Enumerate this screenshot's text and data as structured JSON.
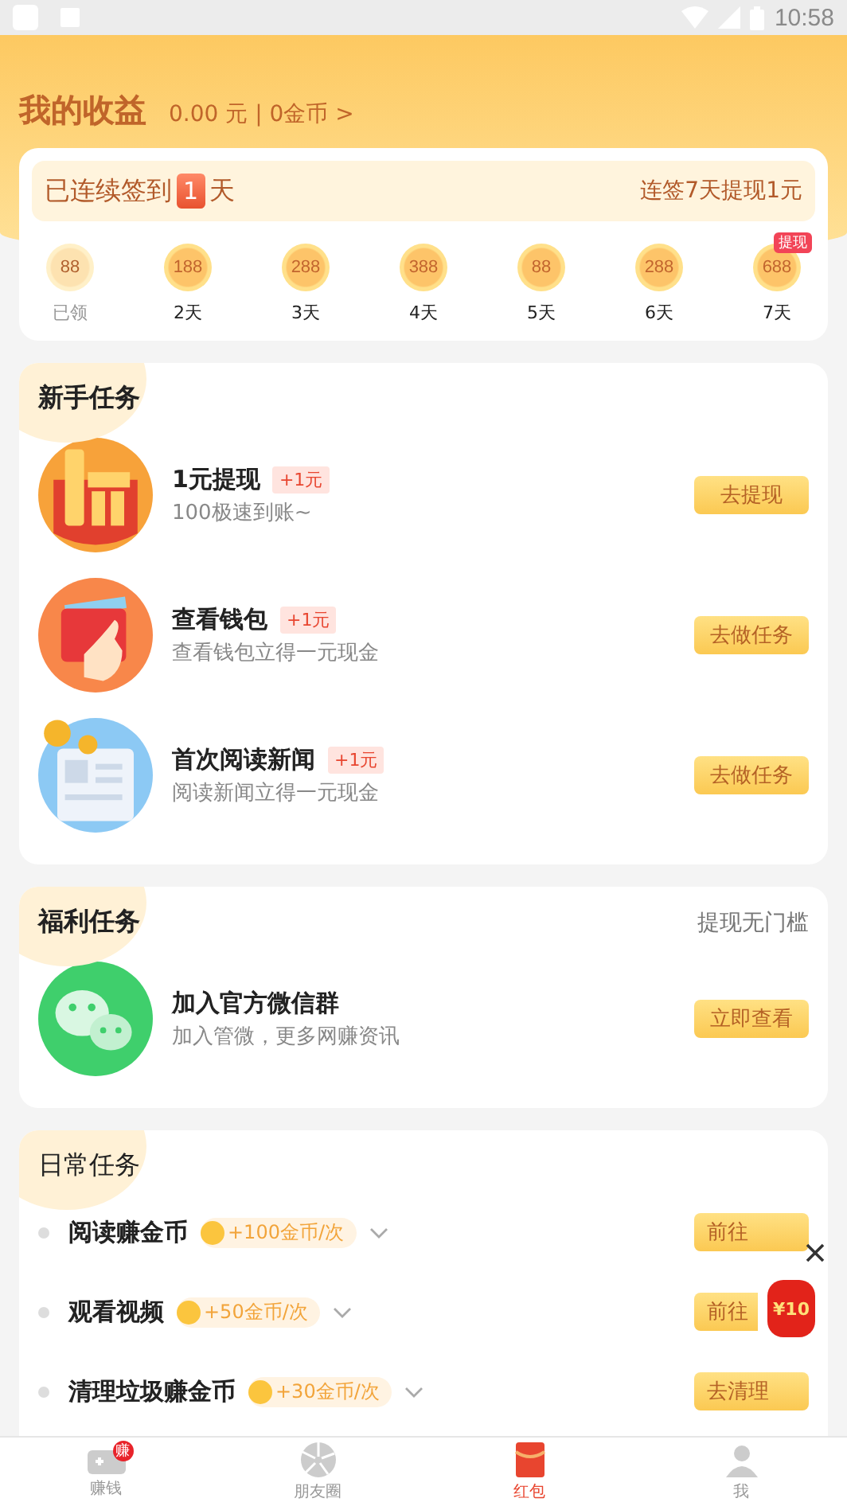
{
  "status_bar": {
    "time": "10:58"
  },
  "header": {
    "title": "我的收益",
    "summary": "0.00 元 | 0金币 >"
  },
  "checkin": {
    "prefix": "已连续签到",
    "days_count": "1",
    "suffix": "天",
    "hint": "连签7天提现1元",
    "days": [
      {
        "amount": "88",
        "label": "已领",
        "claimed": true
      },
      {
        "amount": "188",
        "label": "2天",
        "claimed": false
      },
      {
        "amount": "288",
        "label": "3天",
        "claimed": false
      },
      {
        "amount": "388",
        "label": "4天",
        "claimed": false
      },
      {
        "amount": "88",
        "label": "5天",
        "claimed": false
      },
      {
        "amount": "288",
        "label": "6天",
        "claimed": false
      },
      {
        "amount": "688",
        "label": "7天",
        "claimed": false,
        "badge": "提现"
      }
    ]
  },
  "newbie": {
    "title": "新手任务",
    "tasks": [
      {
        "title": "1元提现",
        "reward": "+1元",
        "subtitle": "100极速到账~",
        "button": "去提现"
      },
      {
        "title": "查看钱包",
        "reward": "+1元",
        "subtitle": "查看钱包立得一元现金",
        "button": "去做任务"
      },
      {
        "title": "首次阅读新闻",
        "reward": "+1元",
        "subtitle": "阅读新闻立得一元现金",
        "button": "去做任务"
      }
    ]
  },
  "welfare": {
    "title": "福利任务",
    "note": "提现无门槛",
    "tasks": [
      {
        "title": "加入官方微信群",
        "subtitle": "加入管微，更多网赚资讯",
        "button": "立即查看"
      }
    ]
  },
  "daily": {
    "title": "日常任务",
    "tasks": [
      {
        "title": "阅读赚金币",
        "reward": "+100金币/次",
        "button": "前往"
      },
      {
        "title": "观看视频",
        "reward": "+50金币/次",
        "button": "前往"
      },
      {
        "title": "清理垃圾赚金币",
        "reward": "+30金币/次",
        "button": "去清理"
      }
    ]
  },
  "floating_ad": {
    "amount": "¥10"
  },
  "nav": [
    {
      "label": "赚钱",
      "selected": false,
      "badge": "赚"
    },
    {
      "label": "朋友圈",
      "selected": false
    },
    {
      "label": "红包",
      "selected": true
    },
    {
      "label": "我",
      "selected": false
    }
  ]
}
